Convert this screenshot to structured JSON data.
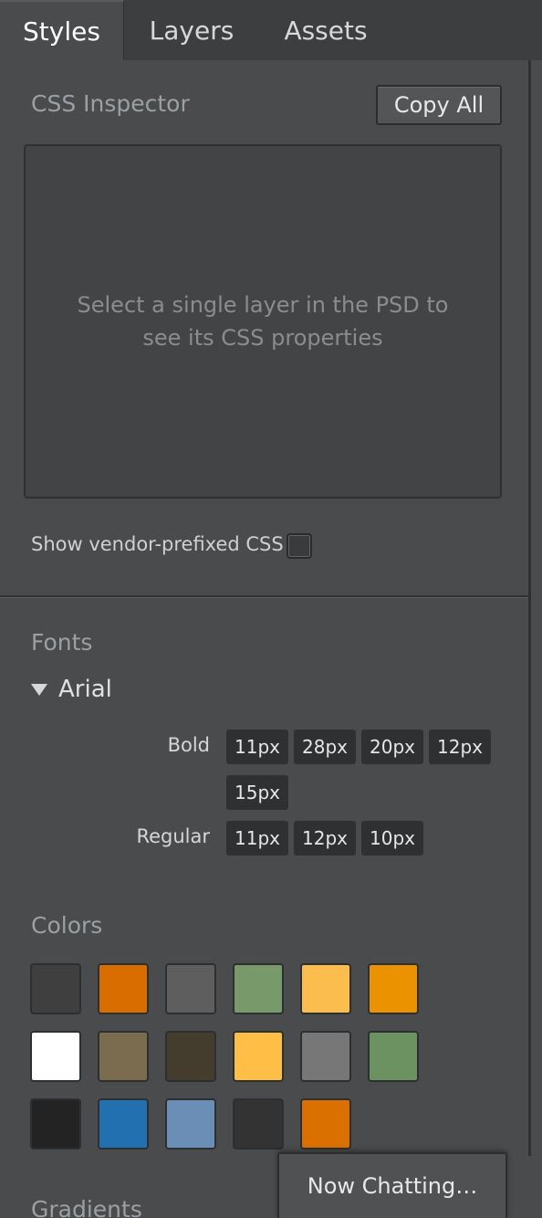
{
  "tabs": [
    {
      "label": "Styles",
      "active": true
    },
    {
      "label": "Layers",
      "active": false
    },
    {
      "label": "Assets",
      "active": false
    }
  ],
  "css_inspector": {
    "title": "CSS Inspector",
    "copy_label": "Copy All",
    "empty_message": "Select a single layer in the PSD to see its CSS properties"
  },
  "vendor": {
    "label": "Show vendor-prefixed CSS",
    "checked": false
  },
  "fonts": {
    "title": "Fonts",
    "family": "Arial",
    "expanded": true,
    "weights": [
      {
        "name": "Bold",
        "sizes": [
          "11px",
          "28px",
          "20px",
          "12px",
          "15px"
        ]
      },
      {
        "name": "Regular",
        "sizes": [
          "11px",
          "12px",
          "10px"
        ]
      }
    ]
  },
  "colors": {
    "title": "Colors",
    "swatches": [
      "#3f3f3f",
      "#d96d00",
      "#5e5e5e",
      "#789969",
      "#fbbd4e",
      "#ea9200",
      "#ffffff",
      "#7b6c50",
      "#443c2c",
      "#ffbf46",
      "#777777",
      "#6c9262",
      "#232323",
      "#2370b1",
      "#6a8eb6",
      "#333333",
      "#d97000"
    ]
  },
  "gradients": {
    "title": "Gradients"
  },
  "chat": {
    "label": "Now Chatting…"
  }
}
